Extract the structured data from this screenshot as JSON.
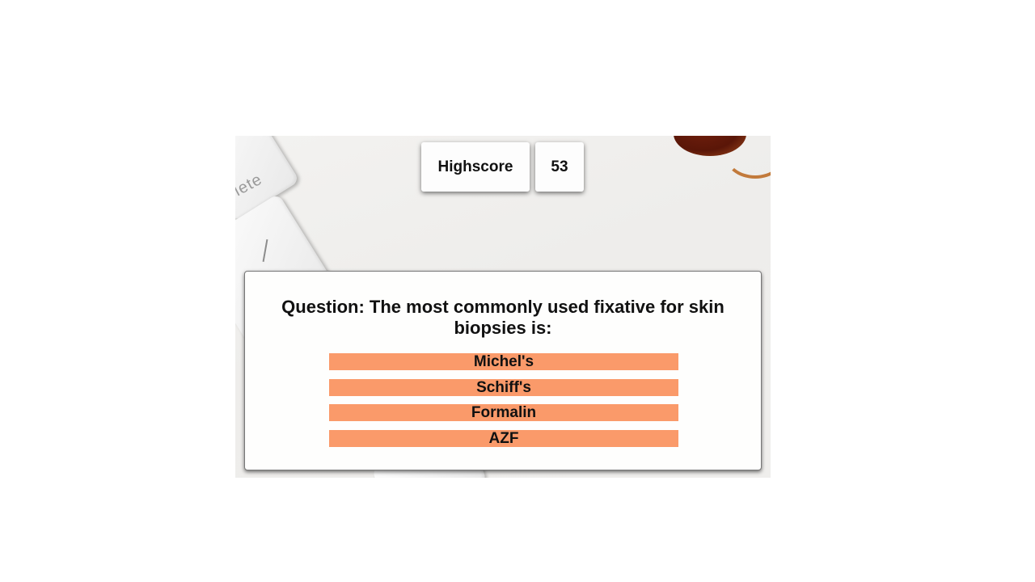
{
  "highscore": {
    "label": "Highscore",
    "value": "53"
  },
  "question": {
    "text": "Question: The most commonly used fixative for skin biopsies is:",
    "answers": [
      "Michel's",
      "Schiff's",
      "Formalin",
      "AZF"
    ]
  },
  "background": {
    "key_label": "lete"
  },
  "colors": {
    "answer_bg": "#fa9a6a",
    "card_bg": "#fefefd"
  }
}
